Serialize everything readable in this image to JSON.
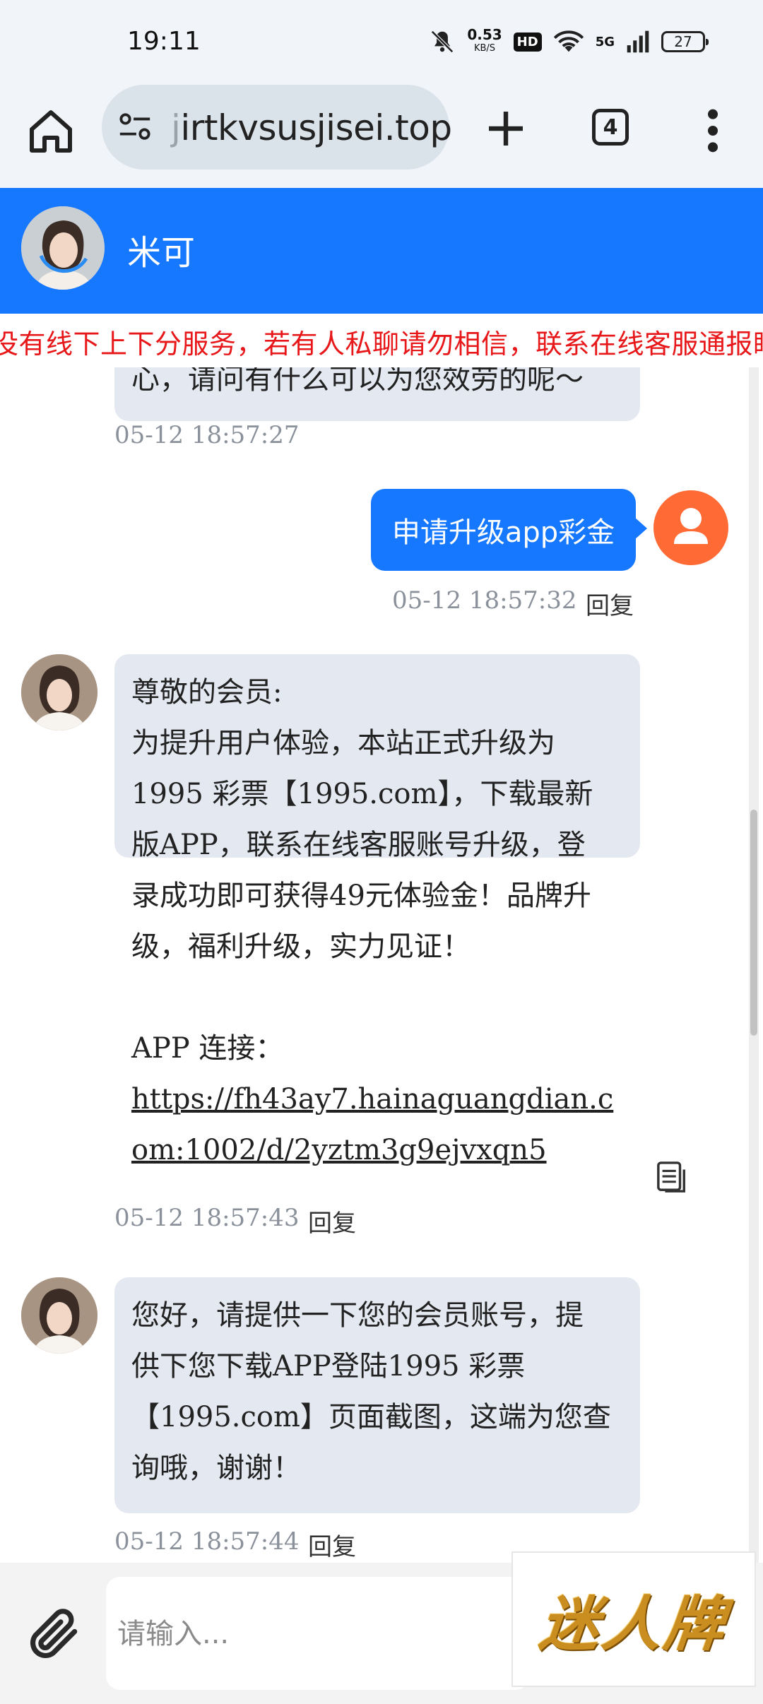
{
  "status_bar": {
    "time": "19:11",
    "net_speed": "0.53",
    "net_unit": "KB/S",
    "hd": "HD",
    "network": "5G",
    "battery": "27"
  },
  "browser": {
    "url_prefix": "j",
    "url": "irtkvsusjisei.top",
    "tab_count": "4"
  },
  "chat": {
    "agent_name": "米可",
    "notice": "没有线下上下分服务，若有人私聊请勿相信，联系在线客服通报眼",
    "messages": [
      {
        "side": "in",
        "text": "心，请问有什么可以为您效劳的呢～",
        "time": "05-12 18:57:27"
      },
      {
        "side": "out",
        "text": "申请升级app彩金",
        "time": "05-12 18:57:32",
        "reply": "回复"
      },
      {
        "side": "in",
        "lines": [
          "尊敬的会员:",
          "为提升用户体验，本站正式升级为",
          "1995 彩票【1995.com】，下载最新",
          "版APP，联系在线客服账号升级，登",
          "录成功即可获得49元体验金！品牌升",
          "级，福利升级，实力见证！",
          "",
          "APP 连接："
        ],
        "link": "https://fh43ay7.hainaguangdian.com:1002/d/2yztm3g9ejvxqn5",
        "time": "05-12 18:57:43",
        "reply": "回复"
      },
      {
        "side": "in",
        "lines": [
          "您好，请提供一下您的会员账号，提",
          "供下您下载APP登陆1995 彩票",
          "【1995.com】页面截图，这端为您查",
          "询哦，谢谢！"
        ],
        "time": "05-12 18:57:44",
        "reply": "回复"
      }
    ]
  },
  "input": {
    "placeholder": "请输入..."
  },
  "ad": {
    "text": "迷人牌"
  },
  "colors": {
    "header_blue": "#1677ff",
    "notice_red": "#e8171a",
    "incoming_bubble": "#e4e9f1",
    "user_avatar": "#ff6a35"
  }
}
